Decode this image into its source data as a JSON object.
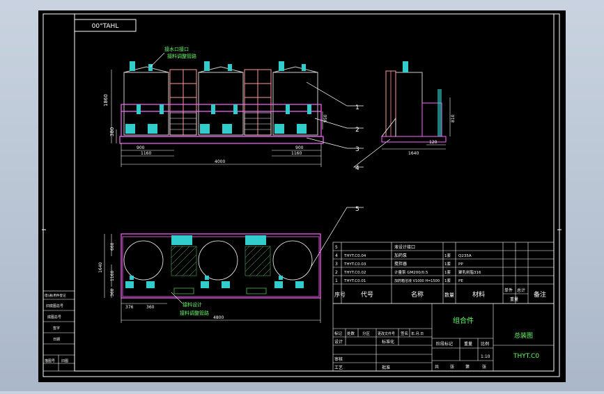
{
  "drawing": {
    "title_box_text": "00°TAHL",
    "colors": {
      "background_gradient_top": "#c9d3e0",
      "sheet": "#000000",
      "frame": "#ffffff",
      "tank": "#ff66ff",
      "pump": "#33cccc",
      "callout": "#ffffff",
      "text_green": "#66ff66"
    },
    "front_view": {
      "annotation_line1": "接水口接口",
      "annotation_line2": "接料调整管路",
      "dims": {
        "height_total": "1860",
        "height_base": "380",
        "width_left": "900",
        "width_right": "900",
        "width_left2": "1160",
        "width_right2": "1160",
        "width_total": "4000",
        "height_right": "950"
      }
    },
    "side_view": {
      "dims": {
        "width": "1640",
        "inner": "120",
        "height": "810"
      }
    },
    "top_view": {
      "annotation_line1": "接料设计",
      "annotation_line2": "接料调整管路",
      "dims": {
        "left_1": "660",
        "left_2": "1640",
        "left_3": "1160",
        "left_4": "360",
        "bottom_1": "376",
        "bottom_2": "360",
        "bottom_total": "4800"
      }
    },
    "callouts": [
      "1",
      "2",
      "3",
      "4",
      "5"
    ],
    "bom": {
      "rows": [
        {
          "no": "5",
          "code": "",
          "name": "液设计接口",
          "qty": "",
          "material": "",
          "note": ""
        },
        {
          "no": "4",
          "code": "THYT.C0.04",
          "name": "加药泵",
          "qty": "1套",
          "material": "Q235A",
          "note": ""
        },
        {
          "no": "3",
          "code": "THYT.C0.03",
          "name": "搅拌器",
          "qty": "1套",
          "material": "PP",
          "note": ""
        },
        {
          "no": "2",
          "code": "THYT.C0.02",
          "name": "计量泵 GM200/0.5",
          "qty": "1套",
          "material": "聚乳树脂316",
          "note": ""
        },
        {
          "no": "1",
          "code": "THYT.C0.01",
          "name": "加药箱溶液 V1000 H=1500",
          "qty": "1套",
          "material": "PE",
          "note": ""
        }
      ],
      "header": {
        "no": "序号",
        "code": "代号",
        "name": "名称",
        "qty": "数量",
        "material": "材料",
        "unit_wt": "单件",
        "total_wt": "总计",
        "weight": "重量",
        "note": "备注"
      }
    },
    "title_block": {
      "assembly_label": "组合件",
      "drawing_name": "总装图",
      "drawing_no": "THYT.C0",
      "row_labels": [
        "标记",
        "处数",
        "分区",
        "更改文件号",
        "签名",
        "年.月.日"
      ],
      "design": "设计",
      "standard": "标准化",
      "stage_mark": "阶段标记",
      "weight": "重量",
      "scale": "比例",
      "scale_value": "1:10",
      "review": "审核",
      "process": "工艺",
      "approve": "批准",
      "sheet_total": "共",
      "sheet_label": "张",
      "sheet_no": "第",
      "sheet_label2": "张"
    },
    "side_table": {
      "rows": [
        "借(通)用件登记",
        "旧底图总号",
        "底图总号",
        "签字",
        "日期"
      ],
      "footer_left": "描图号",
      "footer_right": "旧图"
    }
  }
}
